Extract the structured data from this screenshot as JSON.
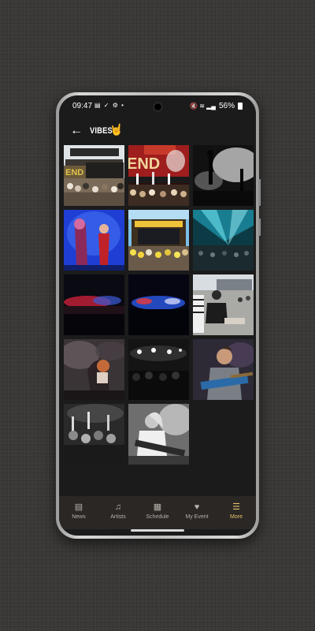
{
  "status_bar": {
    "time": "09:47",
    "left_icons": "▤ ✓ ⚙ •",
    "right_icons": "🔇 ≋ ▂▄",
    "battery": "56%"
  },
  "header": {
    "title": "VIBES",
    "emoji": "🤘"
  },
  "gallery": {
    "photos": [
      {
        "subject": "outdoor festival stage with crowd"
      },
      {
        "subject": "band on red-lit stage with crowd"
      },
      {
        "subject": "silhouetted performers on smoky stage"
      },
      {
        "subject": "two performers under blue light"
      },
      {
        "subject": "large yellow-lit festival stage"
      },
      {
        "subject": "cyan lasers over crowd"
      },
      {
        "subject": "red-lit night stage panorama"
      },
      {
        "subject": "blue-lit night stage panorama"
      },
      {
        "subject": "people sitting on the ground outdoors"
      },
      {
        "subject": "singer under red light"
      },
      {
        "subject": "crowd in black and white"
      },
      {
        "subject": "guitarist in striped shirt"
      },
      {
        "subject": "crowd hands raised in black and white"
      },
      {
        "subject": "guitarist in black and white"
      }
    ]
  },
  "bottom_nav": {
    "items": [
      {
        "label": "News",
        "icon": "▤",
        "name": "news-icon"
      },
      {
        "label": "Artists",
        "icon": "♫",
        "name": "artists-icon"
      },
      {
        "label": "Schedule",
        "icon": "▦",
        "name": "calendar-icon"
      },
      {
        "label": "My Event",
        "icon": "♥",
        "name": "heart-icon"
      },
      {
        "label": "More",
        "icon": "☰",
        "name": "menu-icon"
      }
    ],
    "active_color": "#e5c06b",
    "inactive_color": "#b5b0a8"
  }
}
